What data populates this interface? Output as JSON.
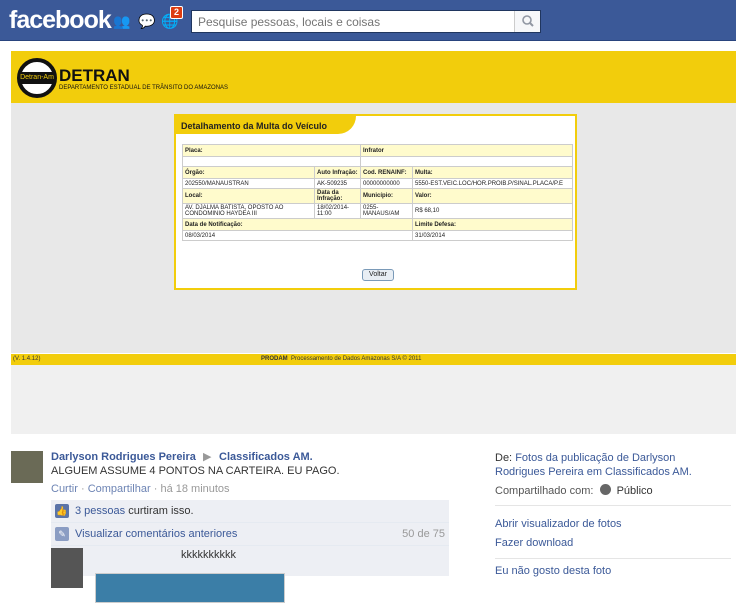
{
  "topbar": {
    "logo": "facebook",
    "notifications_count": "2",
    "search_placeholder": "Pesquise pessoas, locais e coisas"
  },
  "photo": {
    "org_title": "DETRAN",
    "org_subtitle": "DEPARTAMENTO ESTADUAL DE TRÂNSITO DO AMAZONAS",
    "logo_text": "Detran-Am",
    "panel_title": "Detalhamento da Multa do Veículo",
    "labels": {
      "placa": "Placa:",
      "infrator": "Infrator",
      "orgao": "Órgão:",
      "auto_infracao": "Auto Infração:",
      "cod_renainf": "Cod. RENAINF:",
      "multa": "Multa:",
      "local": "Local:",
      "data_infracao": "Data da Infração:",
      "municipio": "Município:",
      "valor": "Valor:",
      "data_notificacao": "Data de Notificação:",
      "limite_defesa": "Limite Defesa:"
    },
    "values": {
      "orgao": "202550/MANAUSTRAN",
      "auto_infracao": "AK-509235",
      "cod_renainf": "00000000000",
      "multa": "5550-EST.VEIC.LOC/HOR.PROIB.P/SINAL.PLACA/P.E",
      "local": "AV. DJALMA BATISTA, OPOSTO AO CONDOMINIO HAYDEA III",
      "data_infracao": "18/02/2014-11:00",
      "municipio": "0255-MANAUS/AM",
      "valor": "R$ 68,10",
      "data_notificacao": "08/03/2014",
      "limite_defesa": "31/03/2014"
    },
    "voltar_label": "Voltar",
    "footer_version": "(V. 1.4.12)",
    "footer_brand": "PRODAM",
    "footer_copy": "Processamento de Dados Amazonas S/A © 2011"
  },
  "post": {
    "author": "Darlyson Rodrigues Pereira",
    "group": "Classificados AM.",
    "text": "ALGUEM ASSUME 4 PONTOS NA CARTEIRA. EU PAGO.",
    "like": "Curtir",
    "share": "Compartilhar",
    "time": "há 18 minutos",
    "likes_link": "3 pessoas",
    "likes_rest": " curtiram isso.",
    "view_prev": "Visualizar comentários anteriores",
    "comments_count": "50 de 75",
    "comment_text": "kkkkkkkkkk"
  },
  "side": {
    "from_label": "De:",
    "from_link": "Fotos da publicação de Darlyson Rodrigues Pereira em Classificados AM.",
    "shared_label": "Compartilhado com:",
    "shared_value": "Público",
    "open_viewer": "Abrir visualizador de fotos",
    "download": "Fazer download",
    "dislike": "Eu não gosto desta foto"
  }
}
